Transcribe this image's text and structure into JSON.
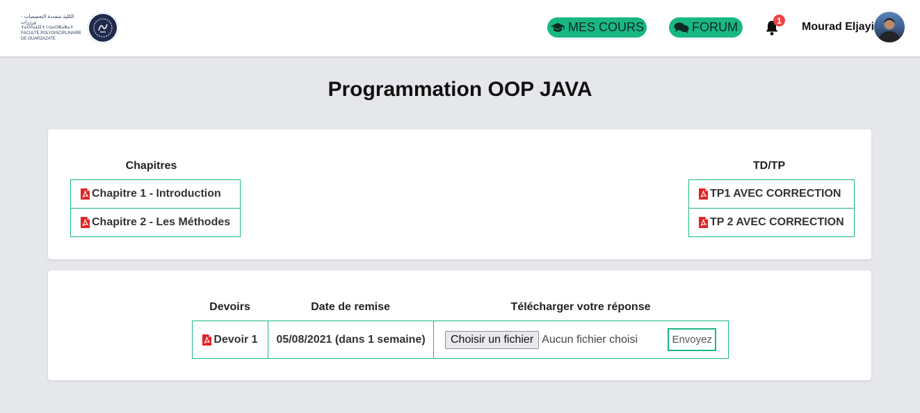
{
  "logo": {
    "line1": "الكلية متعددة التخصصات - ورززات",
    "line2": "ⵜⴰⵙⴷⴰⵡⵉⵜ ⵏ ⵡⴰⵔⵣⴰⵣⴰⵜ",
    "line3": "FACULTE POLYDISCIPLINAIRE DE OUARZAZATE"
  },
  "nav": {
    "courses_label": "MES COURS",
    "forum_label": "FORUM",
    "notifications_count": "1",
    "user_name": "Mourad Eljayi"
  },
  "colors": {
    "accent": "#19b784",
    "badge": "#ef4444",
    "pdf": "#e02424",
    "background": "#e5e7eb"
  },
  "course": {
    "title": "Programmation OOP JAVA"
  },
  "chapters": {
    "heading": "Chapitres",
    "items": [
      {
        "label": "Chapitre 1 - Introduction",
        "icon": "pdf-icon"
      },
      {
        "label": "Chapitre 2 - Les Méthodes",
        "icon": "pdf-icon"
      }
    ]
  },
  "tdtp": {
    "heading": "TD/TP",
    "items": [
      {
        "label": "TP1 AVEC CORRECTION",
        "icon": "pdf-icon"
      },
      {
        "label": "TP 2 AVEC CORRECTION",
        "icon": "pdf-icon"
      }
    ]
  },
  "devoirs": {
    "headers": {
      "devoirs": "Devoirs",
      "date": "Date de remise",
      "upload": "Télécharger votre réponse"
    },
    "rows": [
      {
        "name": "Devoir 1",
        "due": "05/08/2021 (dans 1 semaine)",
        "file_button": "Choisir un fichier",
        "file_status": "Aucun fichier choisi",
        "submit": "Envoyez"
      }
    ]
  }
}
